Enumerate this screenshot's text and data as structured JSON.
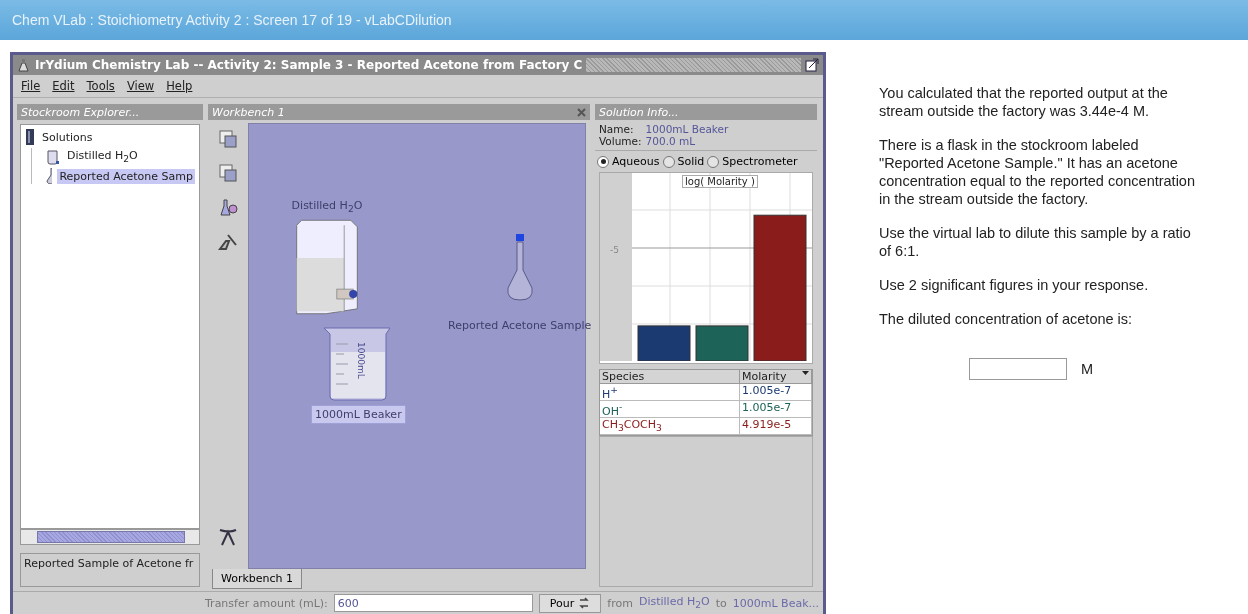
{
  "page_header": {
    "title": "Chem VLab : Stoichiometry Activity 2 : Screen 17 of 19 - vLabCDilution"
  },
  "app_window": {
    "title": "IrYdium Chemistry Lab -- Activity 2: Sample 3 - Reported Acetone from Factory C",
    "menu": [
      "File",
      "Edit",
      "Tools",
      "View",
      "Help"
    ],
    "stockroom": {
      "title": "Stockroom Explorer...",
      "tree": [
        {
          "label": "Solutions",
          "kind": "folder",
          "selected": false,
          "children": [
            {
              "label": "Distilled H$_{2}$O",
              "kind": "bottle",
              "selected": false
            },
            {
              "label": "Reported Acetone Samp",
              "kind": "flask",
              "selected": true
            }
          ]
        }
      ],
      "description": "Reported Sample of Acetone fr"
    },
    "workbench": {
      "title": "Workbench 1",
      "items": [
        {
          "kind": "carboy",
          "label": "Distilled H$_{2}$O",
          "selected": false
        },
        {
          "kind": "beaker",
          "label": "1000mL Beaker",
          "marking": "1000mL",
          "selected": true
        },
        {
          "kind": "flask",
          "label": "Reported Acetone Sample",
          "selected": false
        }
      ],
      "tabs": [
        {
          "label": "Workbench 1",
          "selected": true
        }
      ]
    },
    "solution_info": {
      "title": "Solution Info...",
      "name_label": "Name:",
      "name": "1000mL Beaker",
      "volume_label": "Volume:",
      "volume": "700.0 mL",
      "views": [
        {
          "label": "Aqueous",
          "selected": true
        },
        {
          "label": "Solid",
          "selected": false
        },
        {
          "label": "Spectrometer",
          "selected": false
        }
      ],
      "chart": {
        "title": "log( Molarity )",
        "tick": "-5"
      },
      "columns": [
        "Species",
        "Molarity"
      ],
      "rows": [
        {
          "species": "H$^{+}$",
          "molarity": "1.005e-7",
          "color": "#1c3a72"
        },
        {
          "species": "OH$^{-}$",
          "molarity": "1.005e-7",
          "color": "#1d6358"
        },
        {
          "species": "CH$_{3}$COCH$_{3}$",
          "molarity": "4.919e-5",
          "color": "#8a1c1c"
        }
      ]
    },
    "transfer": {
      "label": "Transfer amount (mL):",
      "value": "600",
      "button": "Pour",
      "from_label": "from",
      "from": "Distilled H$_{2}$O",
      "to_label": "to",
      "to": "1000mL Beak..."
    }
  },
  "instructions": {
    "paragraphs": [
      "You calculated that the reported output at the stream outside the factory was 3.44e-4 M.",
      "There is a flask in the stockroom labeled \"Reported Acetone Sample.\" It has an acetone concentration equal to the reported concentration in the stream outside the factory.",
      "Use the virtual lab to dilute this sample by a ratio of 6:1.",
      "Use 2 significant figures in your response.",
      "The diluted concentration of acetone is:"
    ],
    "answer": {
      "unit": "M"
    }
  }
}
